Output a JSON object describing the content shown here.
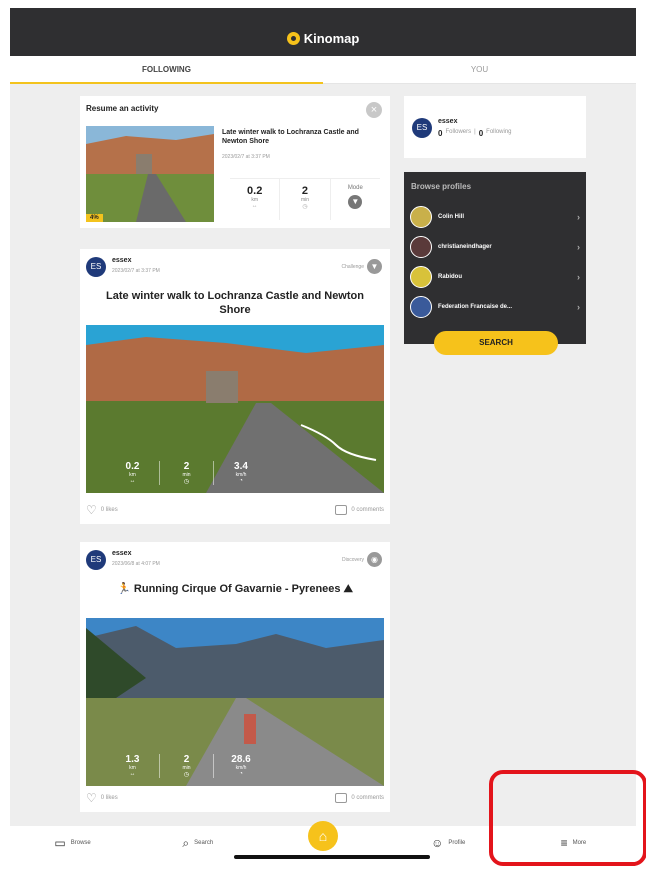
{
  "tabs": [
    {
      "label": "FOLLOWING"
    },
    {
      "label": "YOU"
    }
  ],
  "header": {
    "brand": "Kinomap"
  },
  "resume": {
    "title": "Resume an activity",
    "activity": "Late winter walk to Lochranza Castle and Newton Shore",
    "date": "2023/02/7 at 3:37 PM",
    "badge": "4%",
    "distance": "0.2",
    "distance_unit": "km",
    "time": "2",
    "time_unit": "min",
    "mode_label": "Mode"
  },
  "posts": [
    {
      "avatar": "ES",
      "user": "essex",
      "date": "2023/02/7 at 3:37 PM",
      "type": "Challenge",
      "title": "Late winter walk to Lochranza Castle and Newton Shore",
      "stats": [
        {
          "v": "0.2",
          "u": "km"
        },
        {
          "v": "2",
          "u": "min"
        },
        {
          "v": "3.4",
          "u": "km/h"
        }
      ],
      "likes": "0 likes",
      "comments": "0 comments"
    },
    {
      "avatar": "ES",
      "user": "essex",
      "date": "2023/06/8 at 4:07 PM",
      "type": "Discovery",
      "title": "Running Cirque Of Gavarnie - Pyrenees",
      "stats": [
        {
          "v": "1.3",
          "u": "km"
        },
        {
          "v": "2",
          "u": "min"
        },
        {
          "v": "28.6",
          "u": "km/h"
        }
      ],
      "likes": "0 likes",
      "comments": "0 comments"
    }
  ],
  "profile": {
    "avatar": "ES",
    "name": "essex",
    "followers_count": "0",
    "followers_label": "Followers",
    "following_count": "0",
    "following_label": "Following"
  },
  "browse": {
    "title": "Browse profiles",
    "profiles": [
      {
        "name": "Colin Hill"
      },
      {
        "name": "christianeindhager"
      },
      {
        "name": "Rabidou"
      },
      {
        "name": "Federation Francaise de..."
      }
    ],
    "search_label": "SEARCH"
  },
  "nav": [
    {
      "label": "Browse",
      "icon": "browse-icon"
    },
    {
      "label": "Search",
      "icon": "search-icon"
    },
    {
      "label": "",
      "icon": "home-icon"
    },
    {
      "label": "Profile",
      "icon": "profile-icon"
    },
    {
      "label": "More",
      "icon": "menu-icon"
    }
  ],
  "colors": {
    "accent": "#f6c21b",
    "header": "#2f2f31",
    "highlight": "#e3141b"
  }
}
